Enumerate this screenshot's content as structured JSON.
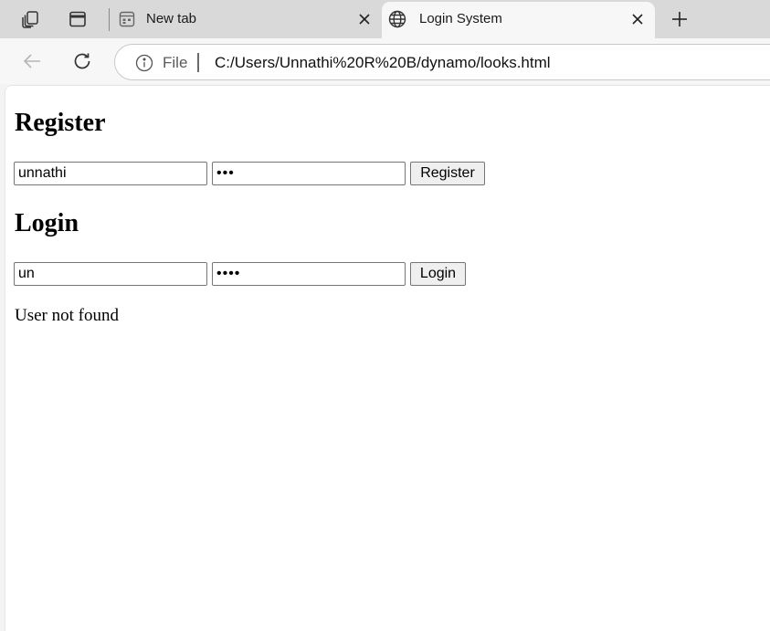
{
  "browser": {
    "tabs": [
      {
        "label": "New tab",
        "icon": "newtab-page-icon",
        "active": false
      },
      {
        "label": "Login System",
        "icon": "globe-icon",
        "active": true
      }
    ],
    "address": {
      "scheme": "File",
      "url": "C:/Users/Unnathi%20R%20B/dynamo/looks.html"
    }
  },
  "page": {
    "register": {
      "heading": "Register",
      "username_value": "unnathi",
      "password_dots": "•••",
      "button_label": "Register"
    },
    "login": {
      "heading": "Login",
      "username_value": "un",
      "password_dots": "••••",
      "button_label": "Login"
    },
    "message": "User not found"
  },
  "colors": {
    "tabstrip_bg": "#d9d9d9",
    "active_tab_bg": "#f7f7f7",
    "page_bg": "#ffffff"
  }
}
